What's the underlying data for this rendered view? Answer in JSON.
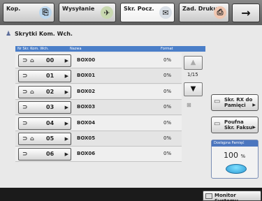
{
  "tabs": [
    {
      "label": "Kop.",
      "icon": "copy-icon"
    },
    {
      "label": "Wysyłanie",
      "icon": "send-icon"
    },
    {
      "label": "Skr. Pocz.",
      "icon": "mailbox-icon",
      "active": true
    },
    {
      "label": "Zad. Druku",
      "icon": "printer-icon"
    }
  ],
  "arrow_label": "→",
  "title": "Skrytki Kom. Wch.",
  "table_headers": [
    "Nr Skr. Kom. Wch.",
    "Nazwa",
    "Format"
  ],
  "rows": [
    {
      "num": "00",
      "name": "BOX00",
      "pct": "0%",
      "locked": true
    },
    {
      "num": "01",
      "name": "BOX01",
      "pct": "0%",
      "locked": false
    },
    {
      "num": "02",
      "name": "BOX02",
      "pct": "0%",
      "locked": true
    },
    {
      "num": "03",
      "name": "BOX03",
      "pct": "0%",
      "locked": false
    },
    {
      "num": "04",
      "name": "BOX04",
      "pct": "0%",
      "locked": false
    },
    {
      "num": "05",
      "name": "BOX05",
      "pct": "0%",
      "locked": true
    },
    {
      "num": "06",
      "name": "BOX06",
      "pct": "0%",
      "locked": false
    }
  ],
  "page_indicator": "1/15",
  "side_buttons": {
    "rx_line1": "Skr. RX do",
    "rx_line2": "Pamięci",
    "secure_line1": "Poufna",
    "secure_line2": "Skr. Faksu"
  },
  "memory": {
    "label": "Dostępna Pamięć",
    "value": "100",
    "unit": "%"
  },
  "status_button": "Monitor Systemu",
  "colors": {
    "accent": "#4a7ec8",
    "memory_disc": "#2f9bd5"
  }
}
